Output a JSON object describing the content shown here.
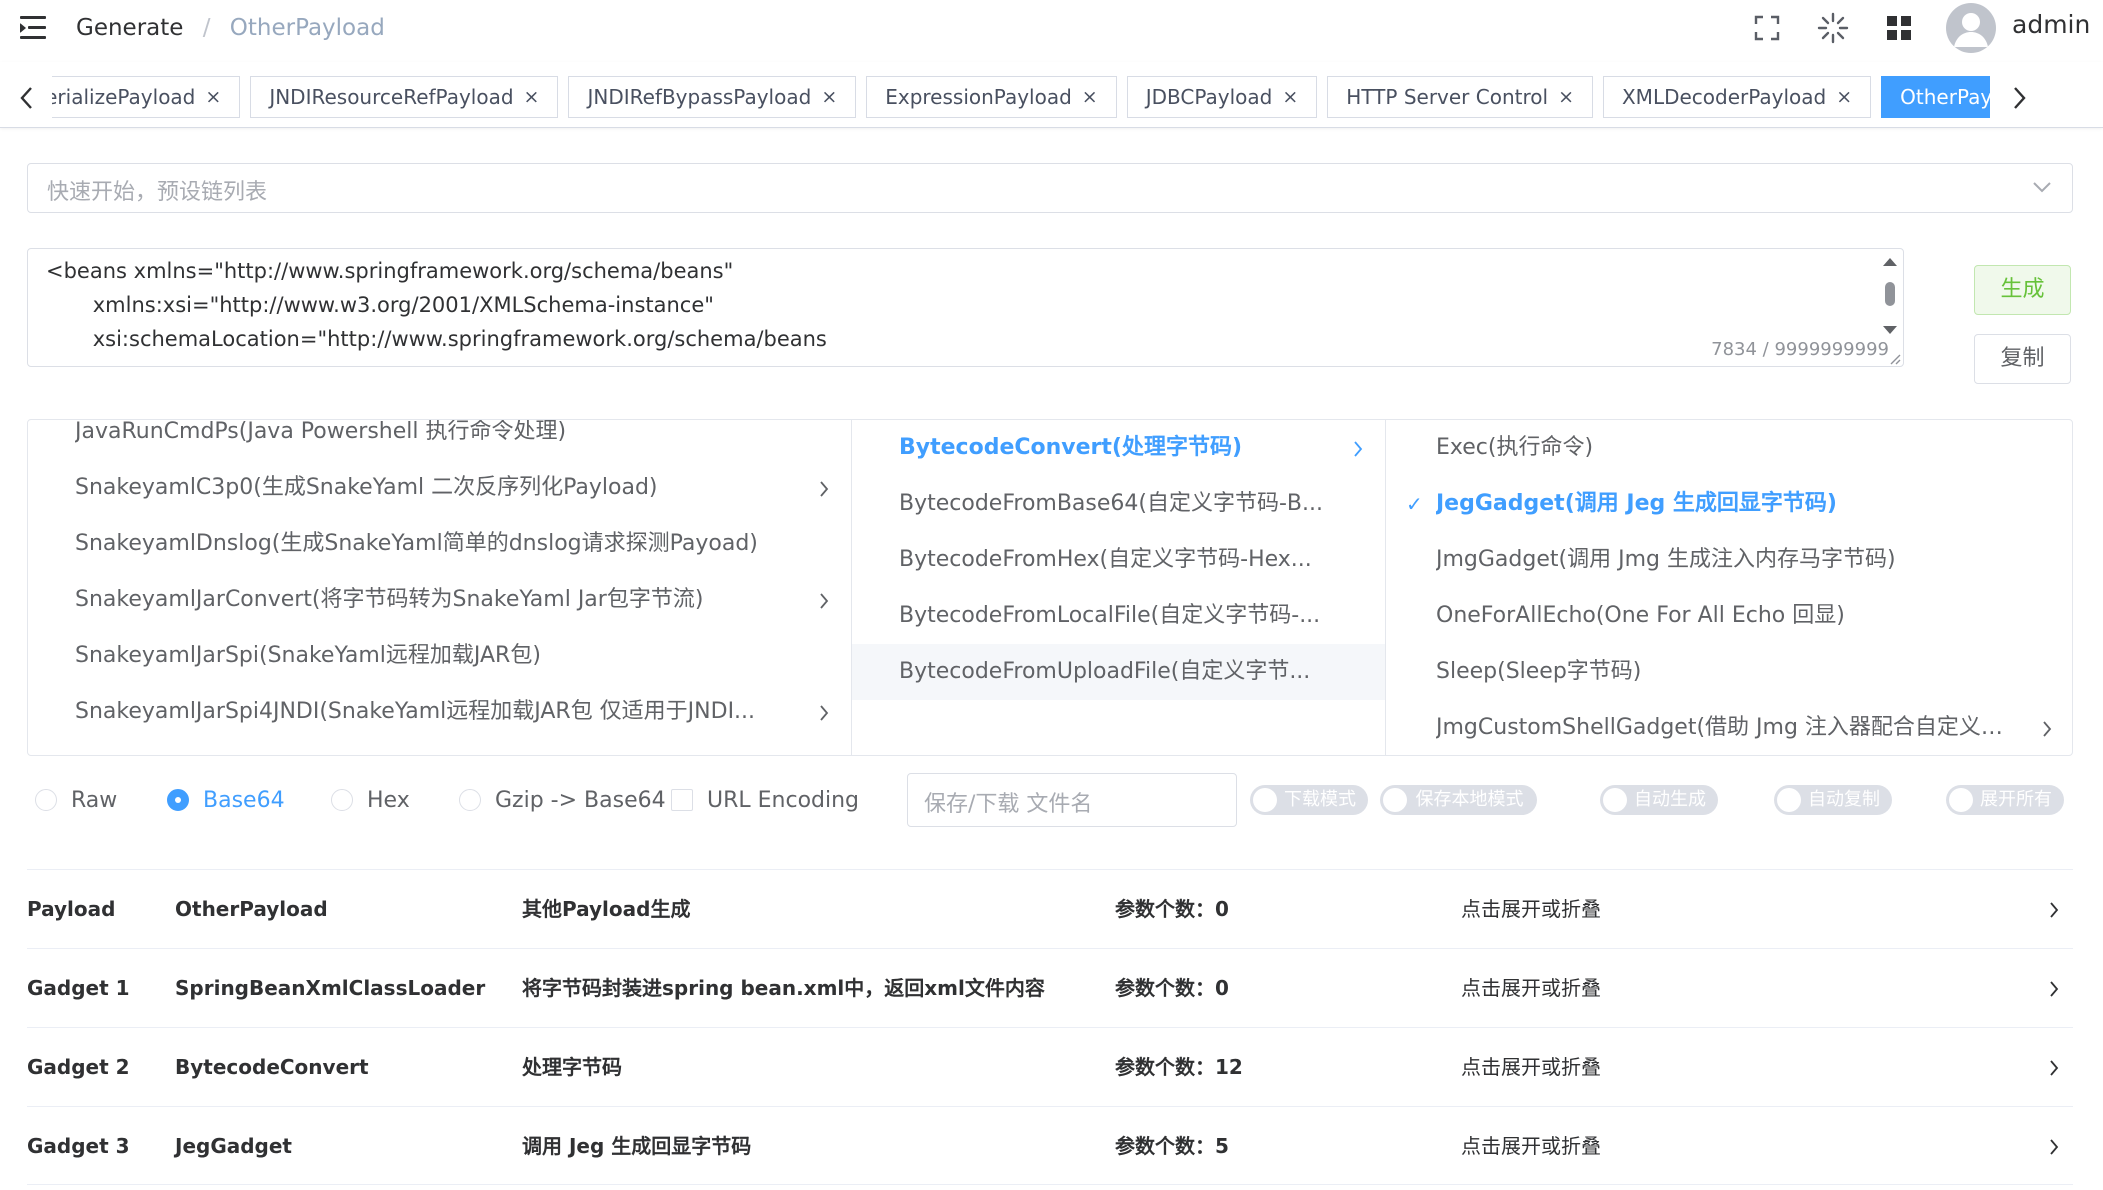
{
  "header": {
    "breadcrumb": [
      "Generate",
      "/",
      "OtherPayload"
    ],
    "user": "admin",
    "icons": [
      "menu-fold-icon",
      "fullscreen-icon",
      "loading-spinner-icon",
      "grid-apps-icon",
      "user-avatar-icon"
    ]
  },
  "tabs": [
    {
      "label": "DeserializePayload"
    },
    {
      "label": "JNDIResourceRefPayload"
    },
    {
      "label": "JNDIRefBypassPayload"
    },
    {
      "label": "ExpressionPayload"
    },
    {
      "label": "JDBCPayload"
    },
    {
      "label": "HTTP Server Control"
    },
    {
      "label": "XMLDecoderPayload"
    },
    {
      "label": "OtherPayload",
      "active": true
    }
  ],
  "quick_select": {
    "placeholder": "快速开始，预设链列表"
  },
  "editor": {
    "lines": [
      "<beans xmlns=\"http://www.springframework.org/schema/beans\"",
      "       xmlns:xsi=\"http://www.w3.org/2001/XMLSchema-instance\"",
      "       xsi:schemaLocation=\"http://www.springframework.org/schema/beans"
    ],
    "count": "7834 / 9999999999"
  },
  "buttons": {
    "generate": "生成",
    "copy": "复制"
  },
  "cascader": {
    "col1": [
      {
        "label": "JavaRunCmdPs(Java Powershell 执行命令处理)",
        "arrow": false
      },
      {
        "label": "SnakeyamlC3p0(生成SnakeYaml 二次反序列化Payload)",
        "arrow": true
      },
      {
        "label": "SnakeyamlDnslog(生成SnakeYaml简单的dnslog请求探测Payoad)",
        "arrow": false
      },
      {
        "label": "SnakeyamlJarConvert(将字节码转为SnakeYaml Jar包字节流)",
        "arrow": true
      },
      {
        "label": "SnakeyamlJarSpi(SnakeYaml远程加载JAR包)",
        "arrow": false
      },
      {
        "label": "SnakeyamlJarSpi4JNDI(SnakeYaml远程加载JAR包 仅适用于JNDI...",
        "arrow": true
      }
    ],
    "col2": [
      {
        "label": "BytecodeConvert(处理字节码)",
        "arrow": true,
        "selected": true
      },
      {
        "label": "BytecodeFromBase64(自定义字节码-B...",
        "arrow": false
      },
      {
        "label": "BytecodeFromHex(自定义字节码-Hex...",
        "arrow": false
      },
      {
        "label": "BytecodeFromLocalFile(自定义字节码-...",
        "arrow": false
      },
      {
        "label": "BytecodeFromUploadFile(自定义字节...",
        "arrow": false,
        "hover": true
      }
    ],
    "col3": [
      {
        "label": "Exec(执行命令)",
        "arrow": false
      },
      {
        "label": "JegGadget(调用 Jeg 生成回显字节码)",
        "arrow": false,
        "selected": true
      },
      {
        "label": "JmgGadget(调用 Jmg 生成注入内存马字节码)",
        "arrow": false
      },
      {
        "label": "OneForAllEcho(One For All Echo 回显)",
        "arrow": false
      },
      {
        "label": "Sleep(Sleep字节码)",
        "arrow": false
      },
      {
        "label": "JmgCustomShellGadget(借助 Jmg 注入器配合自定义马...",
        "arrow": true
      }
    ],
    "check_mark": "✓"
  },
  "encoding": {
    "options": [
      "Raw",
      "Base64",
      "Hex",
      "Gzip -> Base64"
    ],
    "selected": "Base64",
    "url_encoding": "URL Encoding"
  },
  "filename": {
    "placeholder": "保存/下载 文件名"
  },
  "switches": [
    "下载模式",
    "保存本地模式",
    "自动生成",
    "自动复制",
    "展开所有"
  ],
  "gadgets": [
    {
      "kind": "Payload",
      "name": "OtherPayload",
      "desc": "其他Payload生成",
      "params": "参数个数：0",
      "toggle": "点击展开或折叠"
    },
    {
      "kind": "Gadget 1",
      "name": "SpringBeanXmlClassLoader",
      "desc": "将字节码封装进spring bean.xml中，返回xml文件内容",
      "params": "参数个数：0",
      "toggle": "点击展开或折叠"
    },
    {
      "kind": "Gadget 2",
      "name": "BytecodeConvert",
      "desc": "处理字节码",
      "params": "参数个数：12",
      "toggle": "点击展开或折叠"
    },
    {
      "kind": "Gadget 3",
      "name": "JegGadget",
      "desc": "调用 Jeg 生成回显字节码",
      "params": "参数个数：5",
      "toggle": "点击展开或折叠"
    }
  ],
  "colors": {
    "primary": "#409eff",
    "success": "#67c23a",
    "border": "#dcdfe6",
    "text": "#303133"
  }
}
